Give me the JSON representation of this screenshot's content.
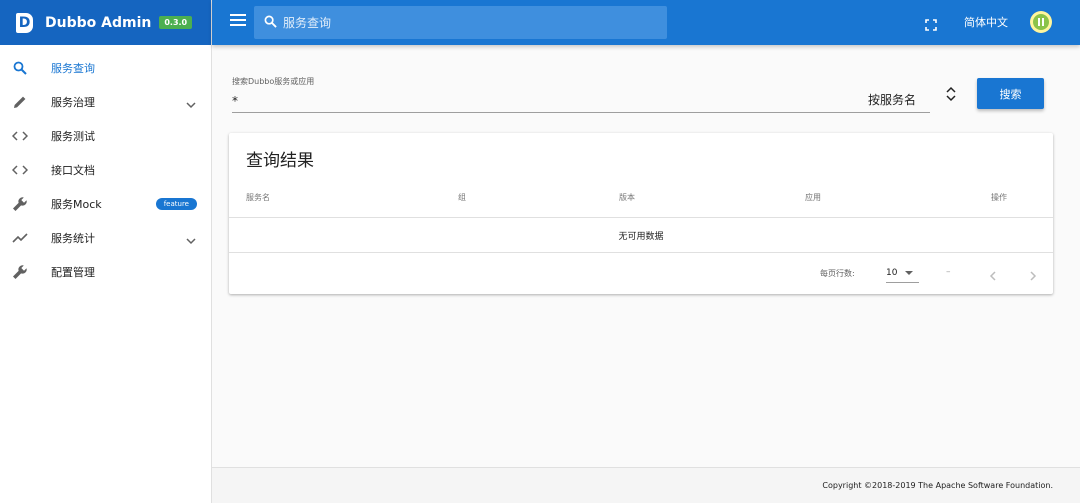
{
  "brand": {
    "logo": "D",
    "title": "Dubbo Admin",
    "version": "0.3.0"
  },
  "sidebar": {
    "items": [
      {
        "label": "服务查询",
        "icon": "search-icon",
        "active": true
      },
      {
        "label": "服务治理",
        "icon": "pencil-icon",
        "expandable": true
      },
      {
        "label": "服务测试",
        "icon": "code-icon"
      },
      {
        "label": "接口文档",
        "icon": "code-icon"
      },
      {
        "label": "服务Mock",
        "icon": "wrench-icon",
        "badge": "feature"
      },
      {
        "label": "服务统计",
        "icon": "trending-icon",
        "expandable": true
      },
      {
        "label": "配置管理",
        "icon": "wrench-icon"
      }
    ]
  },
  "topbar": {
    "search_placeholder": "服务查询",
    "language": "简体中文"
  },
  "search": {
    "label": "搜索Dubbo服务或应用",
    "value": "*",
    "type": "按服务名",
    "button": "搜索"
  },
  "results": {
    "title": "查询结果",
    "columns": [
      "服务名",
      "组",
      "版本",
      "应用",
      "操作"
    ],
    "empty": "无可用数据",
    "rows_per_page_label": "每页行数:",
    "rows_per_page": "10",
    "range": "–"
  },
  "footer": {
    "copyright": "Copyright ©2018-2019 The Apache Software Foundation."
  },
  "colors": {
    "primary": "#1976d2",
    "brand_bar": "#1565c0",
    "version_badge": "#4caf50"
  }
}
